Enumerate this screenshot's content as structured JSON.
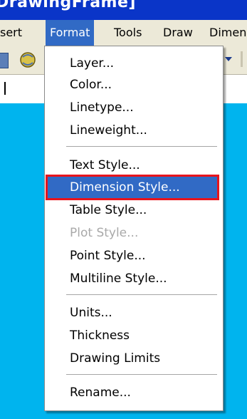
{
  "window": {
    "title": "DrawingFrame]"
  },
  "menubar": {
    "items": [
      {
        "label": "sert"
      },
      {
        "label": "Format"
      },
      {
        "label": "Tools"
      },
      {
        "label": "Draw"
      },
      {
        "label": "Dimen"
      }
    ]
  },
  "format_menu": {
    "group1": [
      "Layer...",
      "Color...",
      "Linetype...",
      "Lineweight..."
    ],
    "group2": [
      "Text Style...",
      "Dimension Style...",
      "Table Style...",
      "Plot Style...",
      "Point Style...",
      "Multiline Style..."
    ],
    "group3": [
      "Units...",
      "Thickness",
      "Drawing Limits"
    ],
    "group4": [
      "Rename..."
    ],
    "highlighted_item": "Dimension Style...",
    "disabled_item": "Plot Style..."
  },
  "colors": {
    "title_bar": "#0a35c8",
    "menu_highlight": "#316ac5",
    "callout_border": "#e8141c",
    "canvas": "#00b4ee"
  }
}
